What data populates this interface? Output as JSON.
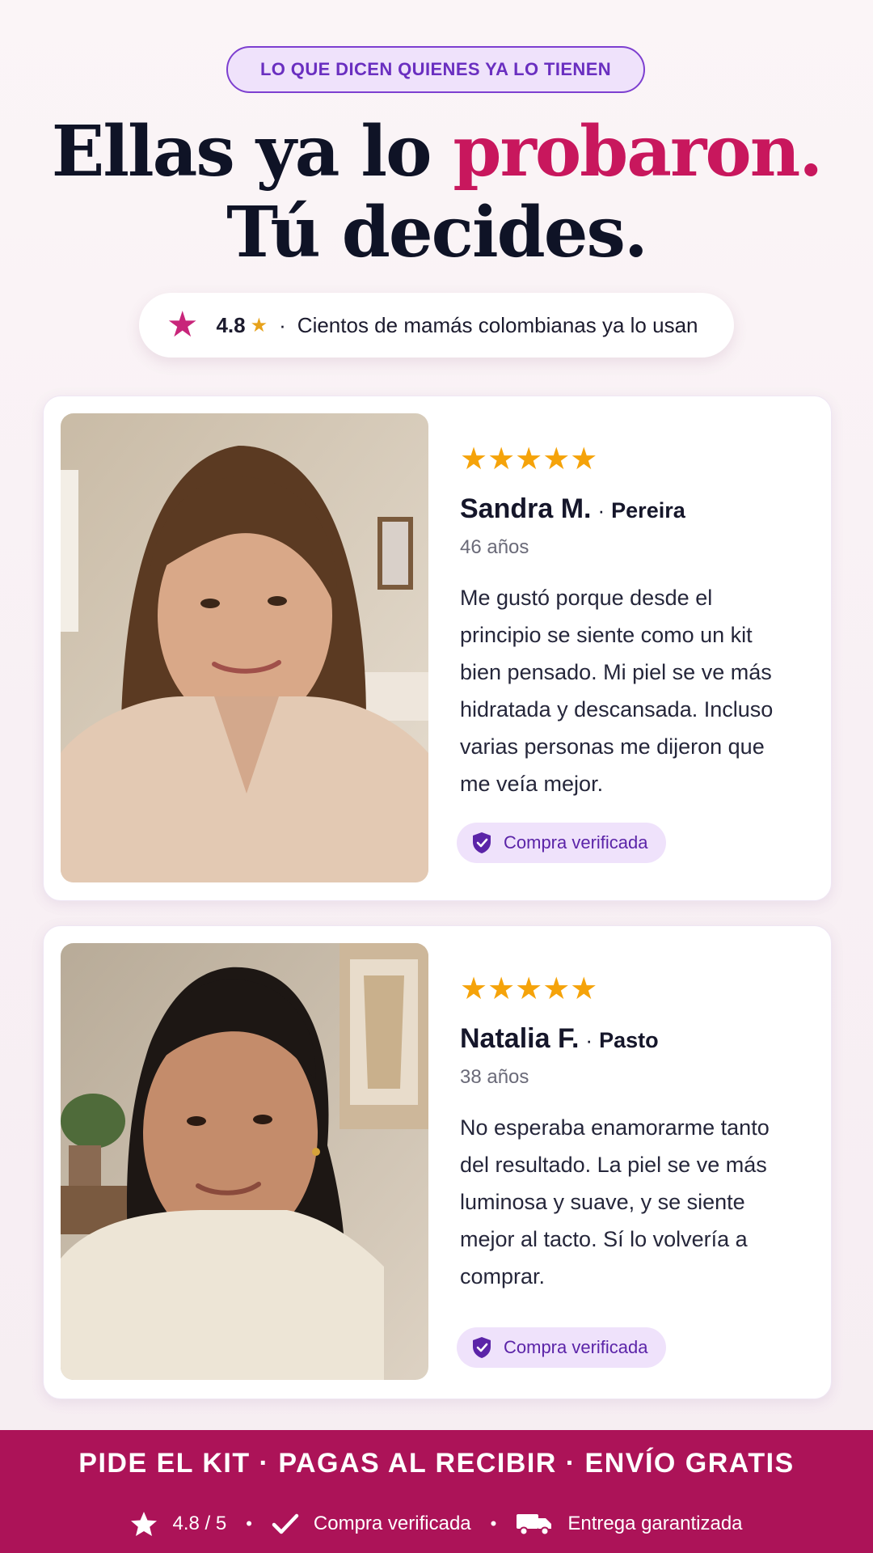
{
  "header": {
    "eyebrow": "LO QUE DICEN QUIENES YA LO TIENEN",
    "headline_part1": "Ellas ya lo ",
    "headline_accent": "probaron.",
    "headline_line2": "Tú decides."
  },
  "rating_bar": {
    "score": "4.8",
    "star": "★",
    "separator": "·",
    "text": "Cientos de mamás colombianas ya lo usan",
    "icon": "star-icon"
  },
  "reviews": [
    {
      "stars": "★★★★★",
      "rating": 5,
      "name": "Sandra M.",
      "separator": "·",
      "city": "Pereira",
      "age": "46 años",
      "text": "Me gustó porque desde el principio se siente como un kit bien pensado. Mi piel se ve más hidratada y descansada. Incluso varias personas me dijeron que me veía mejor.",
      "badge": "Compra verificada"
    },
    {
      "stars": "★★★★★",
      "rating": 5,
      "name": "Natalia F.",
      "separator": "·",
      "city": "Pasto",
      "age": "38 años",
      "text": "No esperaba enamorarme tanto del resultado. La piel se ve más luminosa y suave, y se siente mejor al tacto. Sí lo volvería a comprar.",
      "badge": "Compra verificada"
    }
  ],
  "footer": {
    "cta": "PIDE EL KIT · PAGAS AL RECIBIR · ENVÍO GRATIS",
    "rating": "4.8 / 5",
    "verified": "Compra verificada",
    "delivery": "Entrega garantizada",
    "dot": "•"
  },
  "colors": {
    "accent": "#c8175d",
    "purple": "#6a2fc0",
    "footer_bg": "#ac1358",
    "star": "#f5a30a"
  }
}
